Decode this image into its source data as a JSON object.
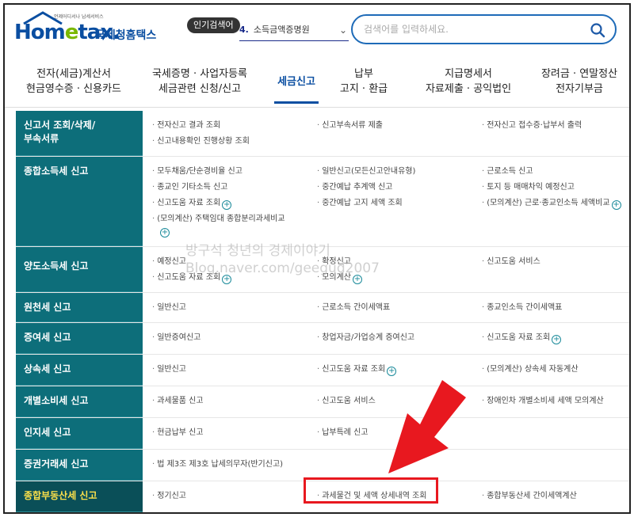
{
  "logo": {
    "tagline": "언제어디서나 납세서비스",
    "brand_a": "Hom",
    "brand_e": "e",
    "brand_b": "tax.",
    "korean": "국세청홈택스"
  },
  "popular": {
    "badge": "인기검색어",
    "rank": "4.",
    "term": "소득금액증명원"
  },
  "search": {
    "placeholder": "검색어를 입력하세요."
  },
  "nav": [
    {
      "l1": "전자(세금)계산서",
      "l2": "현금영수증 · 신용카드"
    },
    {
      "l1": "국세증명 · 사업자등록",
      "l2": "세금관련 신청/신고"
    },
    {
      "l1": "세금신고",
      "l2": ""
    },
    {
      "l1": "납부",
      "l2": "고지 · 환급"
    },
    {
      "l1": "지급명세서",
      "l2": "자료제출 · 공익법인"
    },
    {
      "l1": "장려금 · 연말정산",
      "l2": "전자기부금"
    }
  ],
  "rows": [
    {
      "category": "신고서 조회/삭제/\n부속서류",
      "items": [
        "전자신고 결과 조회",
        "신고부속서류 제출",
        "전자신고 접수증·납부서 출력",
        "신고내용확인 진행상황 조회"
      ]
    },
    {
      "category": "종합소득세 신고",
      "items": [
        "모두채움/단순경비율 신고",
        "일반신고(모든신고안내유형)",
        "근로소득 신고",
        "종교인 기타소득 신고",
        "중간예납 추계액 신고",
        "토지 등 매매차익 예정신고",
        "신고도움 자료 조회",
        "중간예납 고지 세액 조회",
        "(모의계산) 근로·종교인소득 세액비교",
        "(모의계산) 주택임대 종합분리과세비교"
      ]
    },
    {
      "category": "양도소득세 신고",
      "items": [
        "예정신고",
        "확정신고",
        "신고도움 서비스",
        "신고도움 자료 조회",
        "모의계산"
      ]
    },
    {
      "category": "원천세 신고",
      "items": [
        "일반신고",
        "근로소득 간이세액표",
        "종교인소득 간이세액표"
      ]
    },
    {
      "category": "증여세 신고",
      "items": [
        "일반증여신고",
        "창업자금/가업승계 증여신고",
        "신고도움 자료 조회"
      ]
    },
    {
      "category": "상속세 신고",
      "items": [
        "일반신고",
        "신고도움 자료 조회",
        "(모의계산) 상속세 자동계산"
      ]
    },
    {
      "category": "개별소비세 신고",
      "items": [
        "과세물품 신고",
        "신고도움 서비스",
        "장애인차 개별소비세 세액 모의계산"
      ]
    },
    {
      "category": "인지세 신고",
      "items": [
        "현금납부 신고",
        "납부특례 신고"
      ]
    },
    {
      "category": "증권거래세 신고",
      "items": [
        "법 제3조 제3호 납세의무자(반기신고)"
      ]
    },
    {
      "category": "종합부동산세 신고",
      "items": [
        "정기신고",
        "과세물건 및 세액 상세내역 조회",
        "종합부동산세 간이세액계산"
      ]
    }
  ],
  "watermark": {
    "line1": "방구석 청년의 경제이야기",
    "line2": "Blog.naver.com/geegud2007"
  },
  "colors": {
    "accent": "#0a4ea1",
    "category_bg": "#0d6e7a",
    "highlight": "#e8181f"
  }
}
